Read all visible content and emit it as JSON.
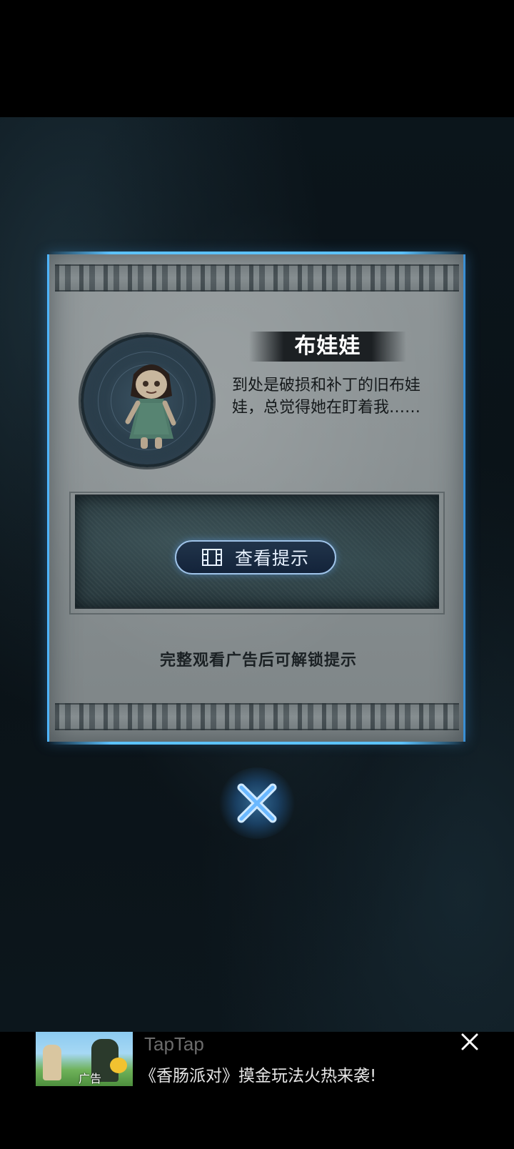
{
  "item": {
    "name": "布娃娃",
    "description": "到处是破损和补丁的旧布娃娃，总觉得她在盯着我……"
  },
  "hint": {
    "button_label": "查看提示",
    "button_icon": "film-icon",
    "unlock_note": "完整观看广告后可解锁提示"
  },
  "close": {
    "icon": "close-x-icon"
  },
  "ad": {
    "title": "TapTap",
    "subtitle": "《香肠派对》摸金玩法火热来袭!",
    "tag": "广告",
    "close_icon": "close-icon"
  },
  "colors": {
    "panel_glow": "#4fb5ff",
    "button_border": "#9fc3e8",
    "text_dark": "#15191b"
  }
}
